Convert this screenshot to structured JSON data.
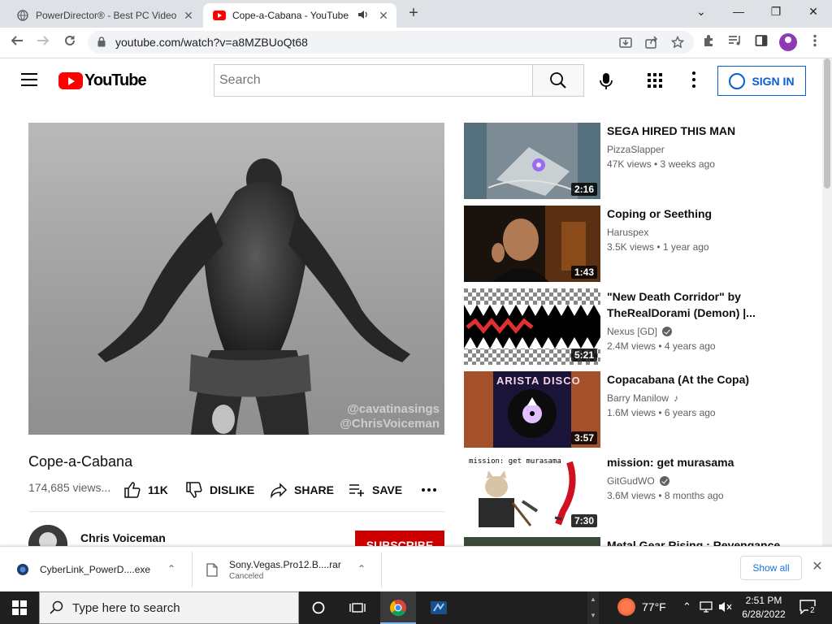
{
  "browser": {
    "tabs": [
      {
        "title": "PowerDirector® - Best PC Video",
        "close": "✕"
      },
      {
        "title": "Cope-a-Cabana - YouTube",
        "close": "✕"
      }
    ],
    "new_tab": "+",
    "window_controls": {
      "dropdown": "⌄",
      "minimize": "—",
      "maximize": "❐",
      "close": "✕"
    },
    "url": "youtube.com/watch?v=a8MZBUoQt68"
  },
  "youtube": {
    "logo_text": "YouTube",
    "search_placeholder": "Search",
    "signin_label": "SIGN IN"
  },
  "video": {
    "title": "Cope-a-Cabana",
    "views": "174,685 views...",
    "likes": "11K",
    "dislike_label": "DISLIKE",
    "share_label": "SHARE",
    "save_label": "SAVE",
    "watermark_line1": "@cavatinasings",
    "watermark_line2": "@ChrisVoiceman",
    "channel_name": "Chris Voiceman",
    "subscribe_label": "SUBSCRIBE"
  },
  "recommendations": [
    {
      "title": "SEGA HIRED THIS MAN",
      "channel": "PizzaSlapper",
      "meta": "47K views • 3 weeks ago",
      "duration": "2:16",
      "verified": false
    },
    {
      "title": "Coping or Seething",
      "channel": "Haruspex",
      "meta": "3.5K views • 1 year ago",
      "duration": "1:43",
      "verified": false
    },
    {
      "title": "\"New Death Corridor\" by TheRealDorami (Demon) |...",
      "channel": "Nexus [GD]",
      "meta": "2.4M views • 4 years ago",
      "duration": "5:21",
      "verified": true
    },
    {
      "title": "Copacabana (At the Copa)",
      "channel": "Barry Manilow",
      "meta": "1.6M views • 6 years ago",
      "duration": "3:57",
      "verified": false,
      "music_note": true
    },
    {
      "title": "mission: get murasama",
      "channel": "GitGudWO",
      "meta": "3.6M views • 8 months ago",
      "duration": "7:30",
      "verified": true
    },
    {
      "title": "Metal Gear Rising : Revengance",
      "channel": "",
      "meta": "",
      "duration": "",
      "verified": false
    }
  ],
  "thumb_text": {
    "arista": "ARISTA DISCO",
    "murasama": "mission: get murasama"
  },
  "downloads": [
    {
      "filename": "CyberLink_PowerD....exe",
      "status": ""
    },
    {
      "filename": "Sony.Vegas.Pro12.B....rar",
      "status": "Canceled"
    }
  ],
  "download_bar": {
    "show_all": "Show all",
    "close": "✕"
  },
  "taskbar": {
    "search_placeholder": "Type here to search",
    "weather": "77°F",
    "time": "2:51 PM",
    "date": "6/28/2022",
    "notifications": "2"
  },
  "colors": {
    "youtube_red": "#ff0000",
    "link_blue": "#065fd4",
    "subscribe_red": "#cc0000",
    "taskbar": "#1f1f1f"
  }
}
